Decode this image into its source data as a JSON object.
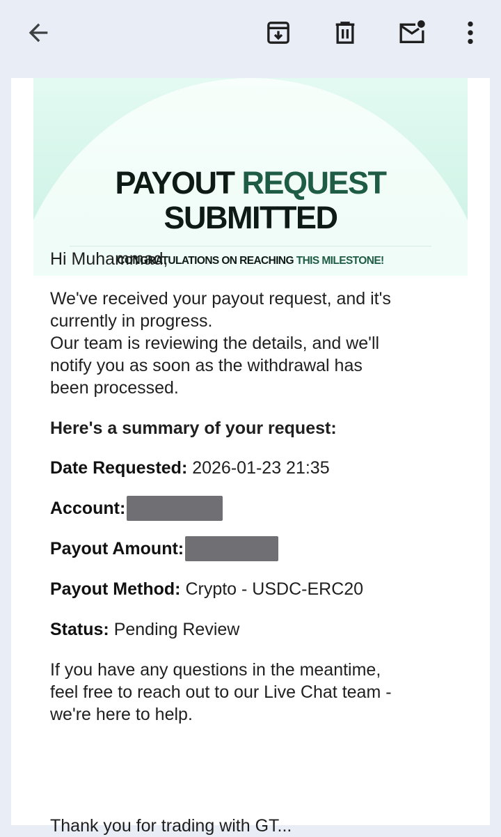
{
  "toolbar": {
    "back_icon": "arrow-back-icon",
    "archive_icon": "archive-icon",
    "delete_icon": "trash-icon",
    "mark_unread_icon": "mail-unread-icon",
    "more_icon": "more-vert-icon"
  },
  "hero": {
    "title_word1": "PAYOUT",
    "title_word2": "REQUEST",
    "title_line2": "SUBMITTED",
    "subtitle_part1": "CONGRATULATIONS ON REACHING",
    "subtitle_part2": "THIS MILESTONE!",
    "accent_color": "#1e5c46"
  },
  "email": {
    "greeting": "Hi Muhammad,",
    "para1_line1": "We've received your payout request, and it's",
    "para1_line2": "currently in progress.",
    "para1_line3": "Our team is reviewing the details, and we'll",
    "para1_line4": "notify you as soon as the withdrawal has",
    "para1_line5": "been processed.",
    "summary_heading": "Here's a summary of your request:",
    "date_label": "Date Requested:",
    "date_value": "2026-01-23 21:35",
    "account_label": "Account:",
    "payout_amount_label": "Payout Amount:",
    "payout_method_label": "Payout Method:",
    "payout_method_value": "Crypto - USDC-ERC20",
    "status_label": "Status:",
    "status_value": "Pending Review",
    "para2_line1": "If you have any questions in the meantime,",
    "para2_line2": "feel free to reach out to our Live Chat team -",
    "para2_line3": "we're here to help.",
    "cut_line": "Thank you for trading with GT..."
  }
}
